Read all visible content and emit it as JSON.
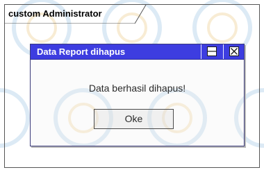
{
  "window": {
    "title": "custom Administrator"
  },
  "dialog": {
    "title": "Data Report dihapus",
    "message": "Data berhasil dihapus!",
    "ok_label": "Oke",
    "maximize_icon": "maximize-icon",
    "close_icon": "close-icon"
  },
  "colors": {
    "titlebar": "#3d3de0",
    "titlebar_text": "#ffffff",
    "frame_border": "#555555",
    "watermark": "#9ec4e4"
  }
}
